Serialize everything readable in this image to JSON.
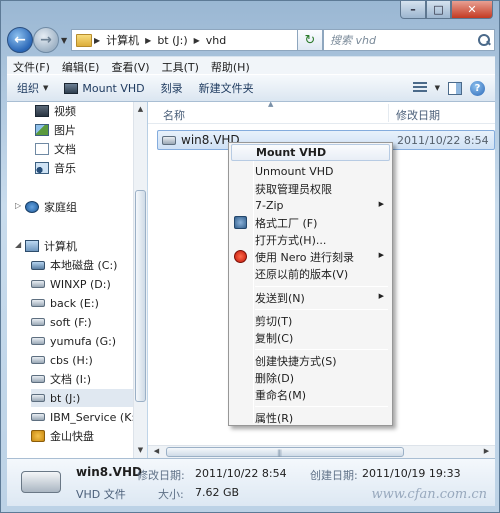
{
  "window": {
    "caption": {
      "minimize": "–",
      "maximize": "□",
      "close": "✕"
    }
  },
  "address": {
    "crumbs": [
      "计算机",
      "bt (J:)",
      "vhd"
    ],
    "search_placeholder": "搜索 vhd"
  },
  "menubar": [
    "文件(F)",
    "编辑(E)",
    "查看(V)",
    "工具(T)",
    "帮助(H)"
  ],
  "cmdbar": {
    "organize": "组织",
    "mount": "Mount VHD",
    "burn": "刻录",
    "new_folder": "新建文件夹"
  },
  "navpane": {
    "libraries": [
      "视频",
      "图片",
      "文档",
      "音乐"
    ],
    "homegroup": "家庭组",
    "computer": "计算机",
    "drives": [
      "本地磁盘 (C:)",
      "WINXP (D:)",
      "back (E:)",
      "soft (F:)",
      "yumufa (G:)",
      "cbs (H:)",
      "文档 (I:)",
      "bt (J:)",
      "IBM_Service (K:)",
      "金山快盘"
    ]
  },
  "filelist": {
    "col_name": "名称",
    "col_date": "修改日期",
    "file": {
      "name": "win8.VHD",
      "date": "2011/10/22 8:54"
    }
  },
  "context_menu": {
    "mount": "Mount VHD",
    "unmount": "Unmount VHD",
    "admin": "获取管理员权限",
    "zip": "7-Zip",
    "format": "格式工厂 (F)",
    "open_with": "打开方式(H)...",
    "nero": "使用 Nero 进行刻录",
    "restore": "还原以前的版本(V)",
    "send_to": "发送到(N)",
    "cut": "剪切(T)",
    "copy": "复制(C)",
    "shortcut": "创建快捷方式(S)",
    "delete": "删除(D)",
    "rename": "重命名(M)",
    "properties": "属性(R)"
  },
  "details": {
    "name": "win8.VHD",
    "type": "VHD 文件",
    "modified_label": "修改日期:",
    "modified": "2011/10/22 8:54",
    "size_label": "大小:",
    "size": "7.62 GB",
    "created_label": "创建日期:",
    "created": "2011/10/19 19:33",
    "watermark": "www.cfan.com.cn"
  }
}
